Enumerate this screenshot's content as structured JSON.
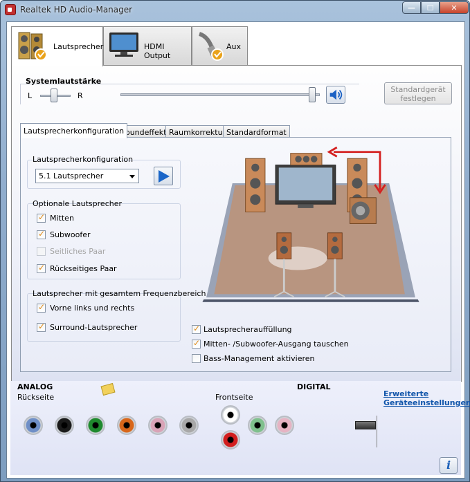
{
  "window": {
    "title": "Realtek HD Audio-Manager",
    "min_symbol": "—",
    "max_symbol": "☐",
    "close_symbol": "✕"
  },
  "device_tabs": [
    {
      "label": "Lautsprecher",
      "icon": "speaker-icon",
      "active": true
    },
    {
      "label": "HDMI Output",
      "icon": "tv-icon",
      "active": false
    },
    {
      "label": "Aux",
      "icon": "aux-cable-icon",
      "active": false
    }
  ],
  "volume": {
    "title": "Systemlautstärke",
    "balance_left": "L",
    "balance_right": "R",
    "balance_level": 0.5,
    "master_level": 0.95,
    "default_button": "Standardgerät festlegen"
  },
  "inner_tabs": [
    {
      "label": "Lautsprecherkonfiguration",
      "active": true
    },
    {
      "label": "Soundeffekt",
      "active": false
    },
    {
      "label": "Raumkorrektur",
      "active": false
    },
    {
      "label": "Standardformat",
      "active": false
    }
  ],
  "config": {
    "group_title": "Lautsprecherkonfiguration",
    "selected": "5.1 Lautsprecher"
  },
  "optional": {
    "group_title": "Optionale Lautsprecher",
    "items": [
      {
        "label": "Mitten",
        "checked": true,
        "enabled": true
      },
      {
        "label": "Subwoofer",
        "checked": true,
        "enabled": true
      },
      {
        "label": "Seitliches Paar",
        "checked": false,
        "enabled": false
      },
      {
        "label": "Rückseitiges Paar",
        "checked": true,
        "enabled": true
      }
    ]
  },
  "fullrange": {
    "group_title": "Lautsprecher mit gesamtem Frequenzbereich",
    "items": [
      {
        "label": "Vorne links und rechts",
        "checked": true
      },
      {
        "label": "Surround-Lautsprecher",
        "checked": true
      }
    ]
  },
  "room_options": [
    {
      "label": "Lautsprecherauffüllung",
      "checked": true
    },
    {
      "label": "Mitten- /Subwoofer-Ausgang tauschen",
      "checked": true
    },
    {
      "label": "Bass-Management aktivieren",
      "checked": false
    }
  ],
  "connectors": {
    "analog_label": "ANALOG",
    "rear_label": "Rückseite",
    "front_label": "Frontseite",
    "digital_label": "DIGITAL",
    "rear_jack_colors": [
      "#6f8fc7",
      "#1a1a1a",
      "#1f8a2e",
      "#d8661a",
      "#d9a3b7",
      "#a8a8a8"
    ],
    "front_jack_colors": [
      "#ffffff",
      "#d21e1e",
      "#7fc08d",
      "#e6b3c3"
    ],
    "advanced_link": "Erweiterte Geräteeinstellungen",
    "info_symbol": "i"
  }
}
